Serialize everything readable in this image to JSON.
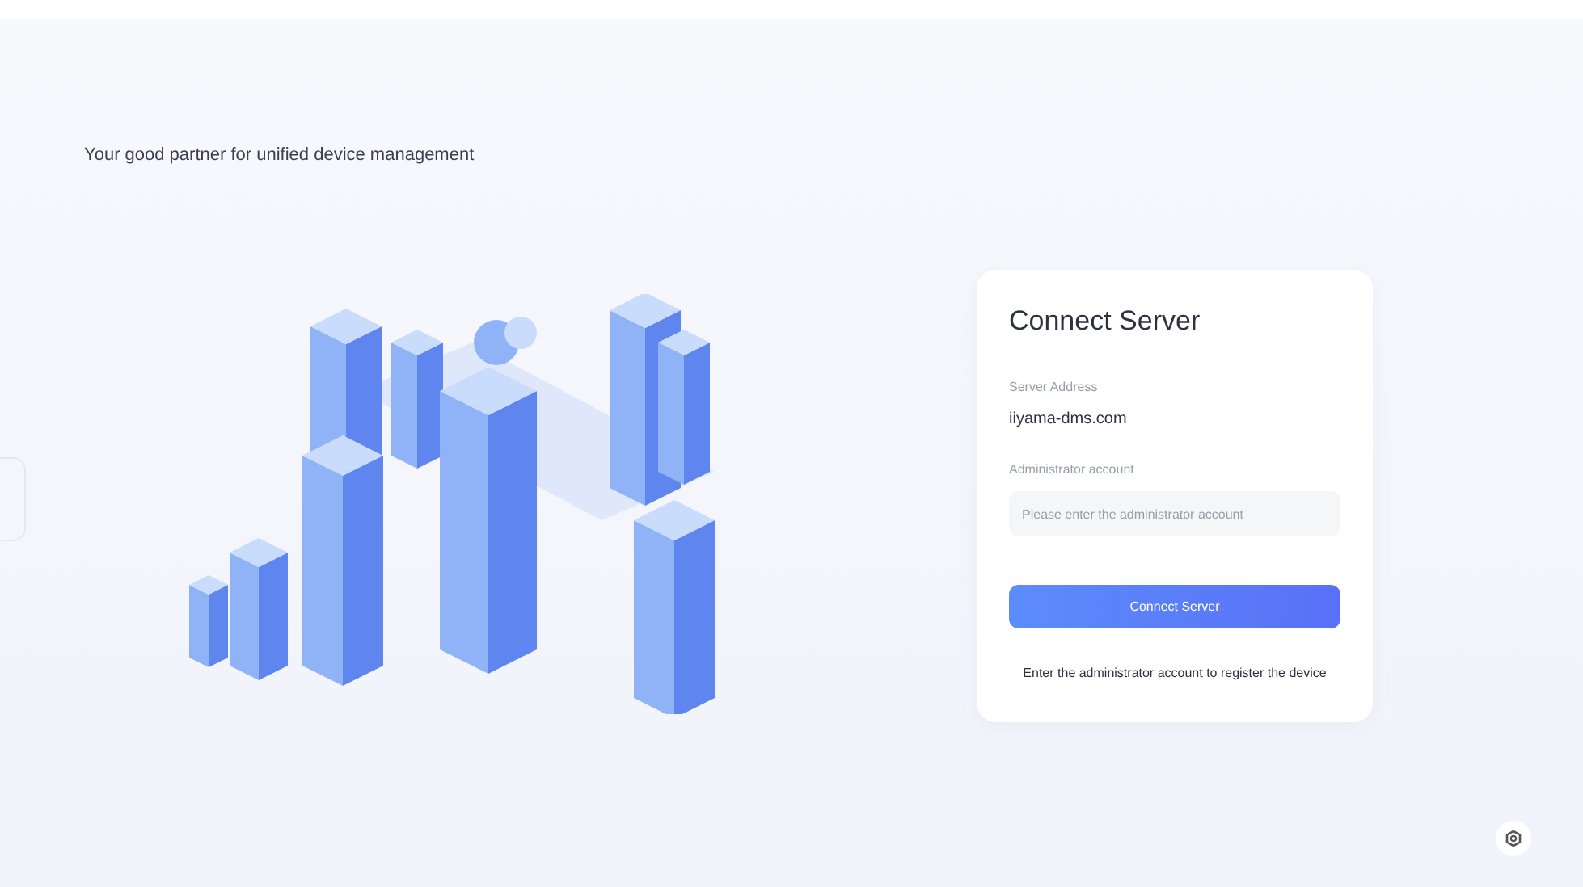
{
  "tagline": "Your good partner for unified device management",
  "card": {
    "title": "Connect Server",
    "server_label": "Server Address",
    "server_value": "iiyama-dms.com",
    "account_label": "Administrator account",
    "account_field": {
      "placeholder": "Please enter the administrator account"
    },
    "button": "Connect Server",
    "hint": "Enter the administrator account to register the device"
  }
}
